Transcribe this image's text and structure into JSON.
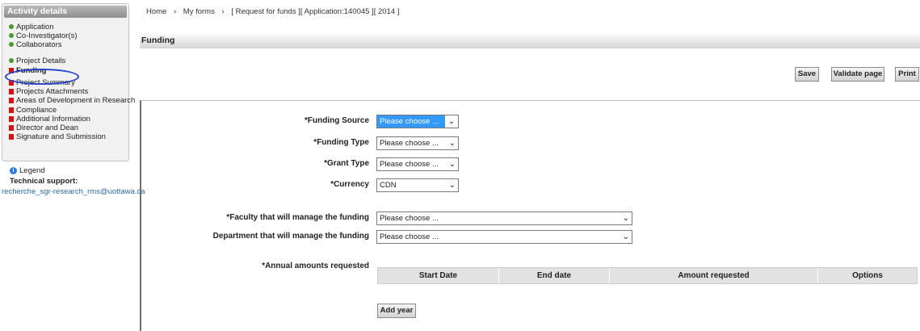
{
  "sidebar": {
    "title": "Activity details",
    "items": [
      {
        "label": "Application",
        "status": "done"
      },
      {
        "label": "Co-Investigator(s)",
        "status": "done"
      },
      {
        "label": "Collaborators",
        "status": "done"
      },
      {
        "label": "Project Details",
        "status": "done"
      },
      {
        "label": "Funding",
        "status": "todo"
      },
      {
        "label": "Project Summary",
        "status": "todo"
      },
      {
        "label": "Projects Attachments",
        "status": "todo"
      },
      {
        "label": "Areas of Development in Research",
        "status": "todo"
      },
      {
        "label": "Compliance",
        "status": "todo"
      },
      {
        "label": "Additional Information",
        "status": "todo"
      },
      {
        "label": "Director and Dean",
        "status": "todo"
      },
      {
        "label": "Signature and Submission",
        "status": "todo"
      }
    ],
    "legend_label": "Legend",
    "tech_support_label": "Technical support:",
    "tech_support_email": "recherche_sgr-research_rms@uottawa.ca"
  },
  "breadcrumb": {
    "home": "Home",
    "sep": "›",
    "my_forms": "My forms",
    "current": "[ Request for funds ][ Application:140045 ][ 2014 ]"
  },
  "section_title": "Funding",
  "toolbar": {
    "save_label": "Save",
    "validate_label": "Validate page",
    "print_label": "Print"
  },
  "form": {
    "funding_source": {
      "label": "*Funding Source",
      "value": "Please choose ..."
    },
    "funding_type": {
      "label": "*Funding Type",
      "value": "Please choose ..."
    },
    "grant_type": {
      "label": "*Grant Type",
      "value": "Please choose ..."
    },
    "currency": {
      "label": "*Currency",
      "value": "CDN"
    },
    "faculty": {
      "label": "*Faculty that will manage the funding",
      "value": "Please choose ..."
    },
    "department": {
      "label": "Department that will manage the funding",
      "value": "Please choose ..."
    },
    "annual_amounts_label": "*Annual amounts requested"
  },
  "annual_table": {
    "columns": [
      "Start Date",
      "End date",
      "Amount requested",
      "Options"
    ]
  },
  "add_year_label": "Add year",
  "colors": {
    "done": "#4d9a2e",
    "todo": "#d81010",
    "selected_highlight": "#3399ff",
    "annotation_circle": "#2844c8",
    "link": "#2b6aa8"
  }
}
